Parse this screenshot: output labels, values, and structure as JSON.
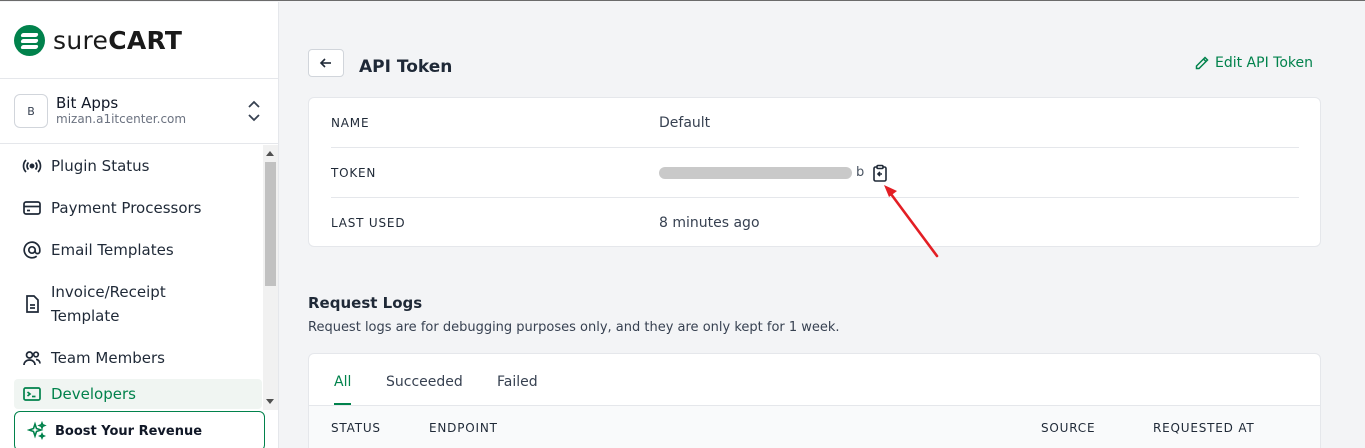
{
  "brand": {
    "light": "sure",
    "bold": "CART"
  },
  "store": {
    "initial": "B",
    "name": "Bit Apps",
    "url": "mizan.a1itcenter.com"
  },
  "nav": {
    "items": [
      {
        "label": "Plugin Status",
        "icon": "broadcast-icon"
      },
      {
        "label": "Payment Processors",
        "icon": "credit-card-icon"
      },
      {
        "label": "Email Templates",
        "icon": "at-sign-icon"
      },
      {
        "label_line1": "Invoice/Receipt",
        "label_line2": "Template",
        "icon": "document-icon"
      },
      {
        "label": "Team Members",
        "icon": "users-icon"
      },
      {
        "label": "Developers",
        "icon": "terminal-icon"
      }
    ]
  },
  "boost": {
    "label": "Boost Your Revenue",
    "icon": "sparkles-icon"
  },
  "header": {
    "title": "API Token",
    "edit_label": "Edit API Token"
  },
  "details": {
    "name_key": "NAME",
    "name_value": "Default",
    "token_key": "TOKEN",
    "token_tail": "b",
    "last_used_key": "LAST USED",
    "last_used_value": "8 minutes ago"
  },
  "logs": {
    "title": "Request Logs",
    "description": "Request logs are for debugging purposes only, and they are only kept for 1 week.",
    "tabs": [
      "All",
      "Succeeded",
      "Failed"
    ],
    "columns": [
      "STATUS",
      "ENDPOINT",
      "SOURCE",
      "REQUESTED AT"
    ]
  },
  "colors": {
    "accent": "#01824c",
    "annotation": "#e31e24"
  }
}
